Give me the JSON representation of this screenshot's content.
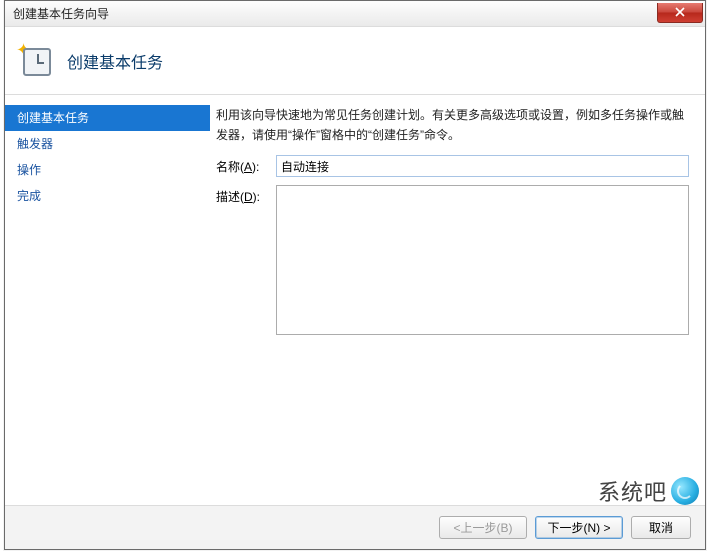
{
  "window": {
    "title": "创建基本任务向导"
  },
  "header": {
    "title": "创建基本任务"
  },
  "sidebar": {
    "items": [
      {
        "label": "创建基本任务",
        "selected": true
      },
      {
        "label": "触发器",
        "selected": false
      },
      {
        "label": "操作",
        "selected": false
      },
      {
        "label": "完成",
        "selected": false
      }
    ]
  },
  "main": {
    "intro": "利用该向导快速地为常见任务创建计划。有关更多高级选项或设置，例如多任务操作或触发器，请使用“操作”窗格中的“创建任务”命令。",
    "name_label_prefix": "名称(",
    "name_label_key": "A",
    "name_label_suffix": "):",
    "name_value": "自动连接",
    "desc_label_prefix": "描述(",
    "desc_label_key": "D",
    "desc_label_suffix": "):",
    "desc_value": ""
  },
  "footer": {
    "back": "<上一步(B)",
    "next": "下一步(N) >",
    "cancel": "取消"
  },
  "watermark": {
    "text": "系统吧"
  }
}
